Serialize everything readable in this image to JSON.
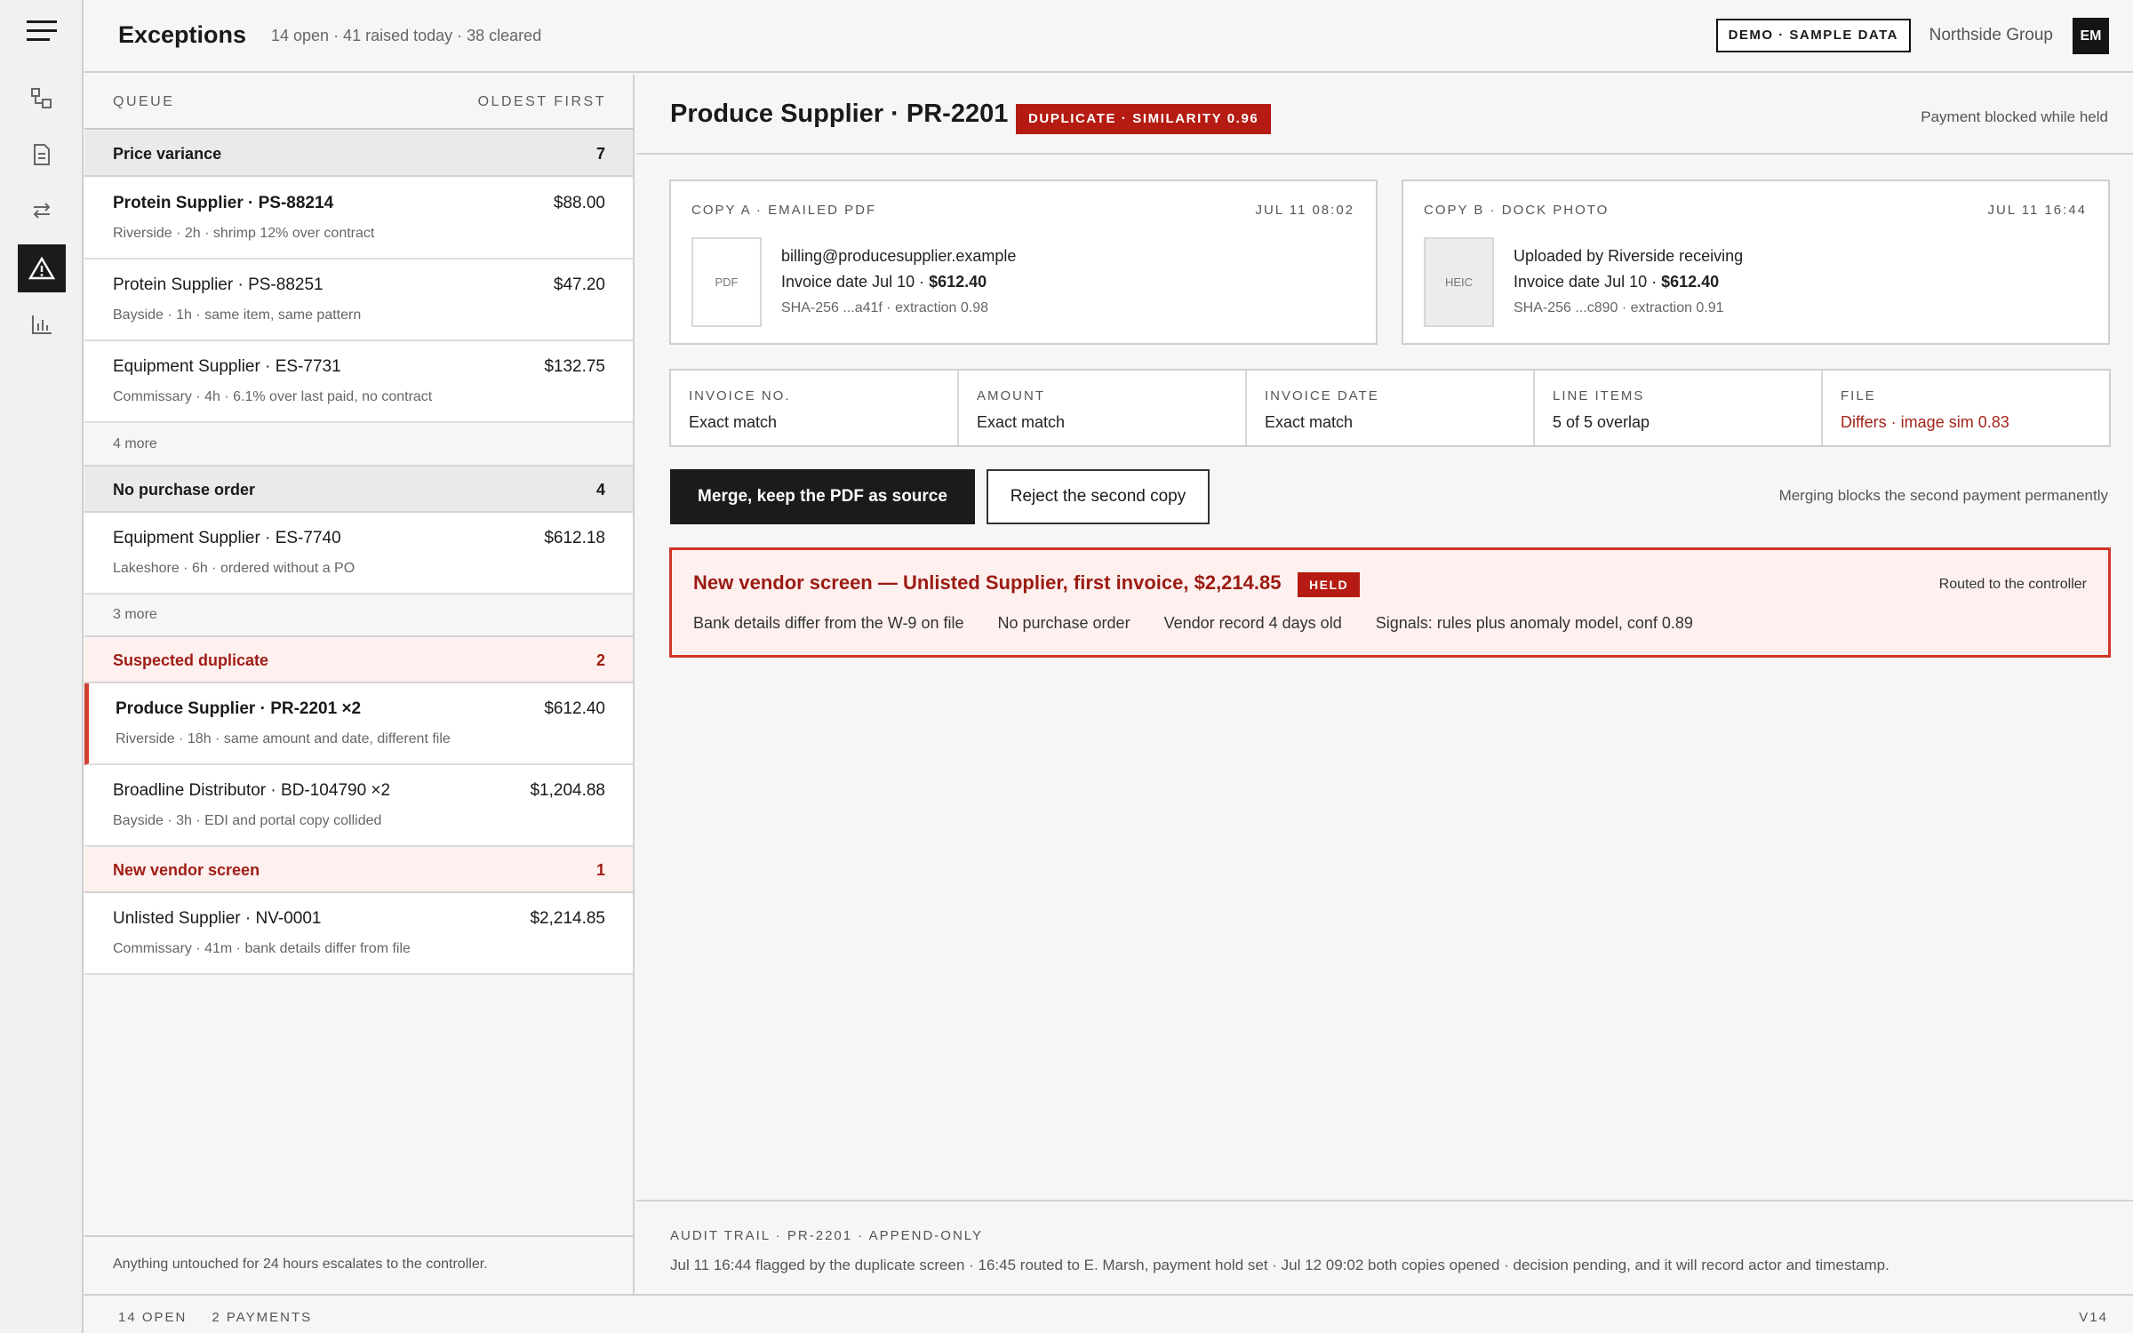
{
  "header": {
    "title": "Exceptions",
    "summary": "14 open · 41 raised today · 38 cleared",
    "demo_badge": "DEMO · SAMPLE DATA",
    "org_name": "Northside Group",
    "avatar_initials": "EM"
  },
  "rail": {
    "items": [
      {
        "icon": "menu-icon"
      },
      {
        "icon": "workflow-icon"
      },
      {
        "icon": "document-icon"
      },
      {
        "icon": "sync-icon"
      },
      {
        "icon": "warning-icon",
        "active": true
      },
      {
        "icon": "chart-icon"
      }
    ]
  },
  "queue": {
    "label": "QUEUE",
    "sort": "OLDEST FIRST",
    "groups": [
      {
        "name": "Price variance",
        "count": "7"
      },
      {
        "name": "No purchase order",
        "count": "4"
      },
      {
        "name": "Suspected duplicate",
        "count": "2"
      },
      {
        "name": "New vendor screen",
        "count": "1"
      }
    ],
    "items": [
      {
        "title": "Protein Supplier · PS-88214",
        "amount": "$88.00",
        "meta": "Riverside · 2h · shrimp 12% over contract"
      },
      {
        "title": "Protein Supplier · PS-88251",
        "amount": "$47.20",
        "meta": "Bayside · 1h · same item, same pattern"
      },
      {
        "title": "Equipment Supplier · ES-7731",
        "amount": "$132.75",
        "meta": "Commissary · 4h · 6.1% over last paid, no contract"
      },
      {
        "title": "Equipment Supplier · ES-7740",
        "amount": "$612.18",
        "meta": "Lakeshore · 6h · ordered without a PO"
      },
      {
        "title": "Produce Supplier · PR-2201 ×2",
        "amount": "$612.40",
        "meta": "Riverside · 18h · same amount and date, different file"
      },
      {
        "title": "Broadline Distributor · BD-104790 ×2",
        "amount": "$1,204.88",
        "meta": "Bayside · 3h · EDI and portal copy collided"
      },
      {
        "title": "Unlisted Supplier · NV-0001",
        "amount": "$2,214.85",
        "meta": "Commissary · 41m · bank details differ from file"
      }
    ],
    "more": [
      "4 more",
      "3 more"
    ],
    "footer": "Anything untouched for 24 hours escalates to the controller."
  },
  "case": {
    "title": "Produce Supplier · PR-2201",
    "badge": "DUPLICATE · SIMILARITY 0.96",
    "hold_note": "Payment blocked while held",
    "copies": [
      {
        "label": "COPY A · EMAILED PDF",
        "time": "JUL 11 08:02",
        "thumb": "PDF",
        "line1": "billing@producesupplier.example",
        "date_text": "Invoice date Jul 10 · ",
        "amount": "$612.40",
        "line3": "SHA-256 ...a41f · extraction 0.98"
      },
      {
        "label": "COPY B · DOCK PHOTO",
        "time": "JUL 11 16:44",
        "thumb": "HEIC",
        "line1": "Uploaded by Riverside receiving",
        "date_text": "Invoice date Jul 10 · ",
        "amount": "$612.40",
        "line3": "SHA-256 ...c890 · extraction 0.91"
      }
    ],
    "compare": [
      {
        "label": "INVOICE NO.",
        "value": "Exact match"
      },
      {
        "label": "AMOUNT",
        "value": "Exact match"
      },
      {
        "label": "INVOICE DATE",
        "value": "Exact match"
      },
      {
        "label": "LINE ITEMS",
        "value": "5 of 5 overlap"
      },
      {
        "label": "FILE",
        "value": "Differs · image sim 0.83"
      }
    ],
    "actions": {
      "merge": "Merge, keep the PDF as source",
      "reject": "Reject the second copy",
      "note": "Merging blocks the second payment permanently"
    }
  },
  "alert": {
    "title": "New vendor screen — Unlisted Supplier, first invoice, $2,214.85",
    "badge": "HELD",
    "route": "Routed to the controller",
    "details": [
      "Bank details differ from the W-9 on file",
      "No purchase order",
      "Vendor record 4 days old",
      "Signals: rules plus anomaly model, conf 0.89"
    ]
  },
  "audit": {
    "label": "AUDIT TRAIL · PR-2201 · APPEND-ONLY",
    "text": "Jul 11 16:44 flagged by the duplicate screen · 16:45 routed to E. Marsh, payment hold set · Jul 12 09:02 both copies opened · decision pending, and it will record actor and timestamp."
  },
  "status": {
    "open": "14 OPEN",
    "payments": "2 PAYMENTS",
    "version": "V14"
  },
  "colors": {
    "accent_red": "#b51b12",
    "alert_bg": "#fdf0ef",
    "dark": "#1b1b1b"
  }
}
